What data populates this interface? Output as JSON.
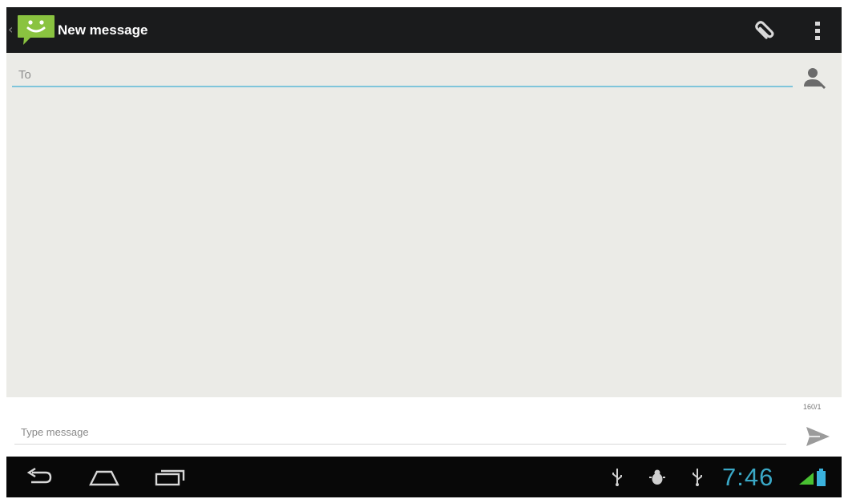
{
  "action_bar": {
    "title": "New message",
    "icons": {
      "up": "chevron-left-icon",
      "app": "messaging-app-icon",
      "attach": "paperclip-icon",
      "overflow": "more-vertical-icon"
    }
  },
  "compose": {
    "to_placeholder": "To",
    "to_value": "",
    "contact_icon": "add-contact-icon"
  },
  "message": {
    "counter": "160/1",
    "placeholder": "Type message",
    "value": "",
    "send_icon": "send-icon"
  },
  "system_bar": {
    "clock": "7:46",
    "nav_icons": [
      "back-icon",
      "home-icon",
      "recent-apps-icon"
    ],
    "notification_icons": [
      "usb-icon",
      "debug-icon",
      "usb-icon"
    ],
    "status_icons": [
      "signal-icon",
      "battery-icon"
    ]
  },
  "colors": {
    "action_bar": "#1a1b1c",
    "compose_background": "#ebebe7",
    "focus_accent": "#7fc5db",
    "clock": "#3aa8c6",
    "app_icon": "#8ac340",
    "system_bar": "#080808"
  }
}
